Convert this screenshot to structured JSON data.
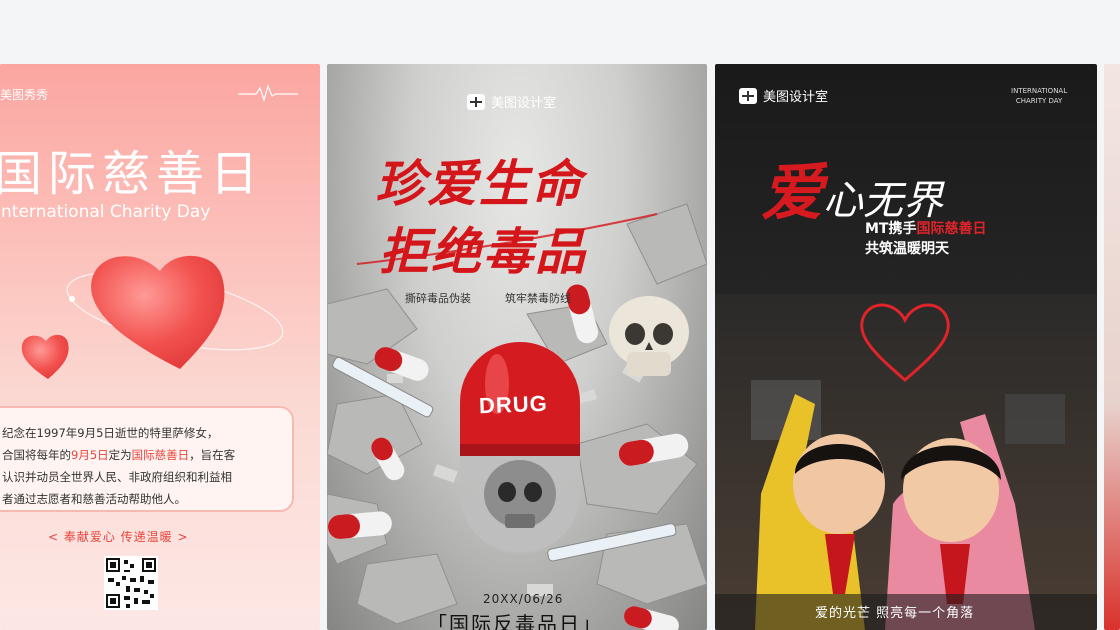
{
  "card1": {
    "brand": "美图秀秀",
    "title": "国际慈善日",
    "subtitle": "International Charity Day",
    "body_line1": "纪念在1997年9月5日逝世的特里萨修女，",
    "body_line2_pre": "合国将每年的",
    "body_line2_date": "9月5日",
    "body_line2_mid": "定为",
    "body_line2_name": "国际慈善日",
    "body_line2_post": "，旨在客",
    "body_line3": "认识并动员全世界人民、非政府组织和利益相",
    "body_line4": "者通过志愿者和慈善活动帮助他人。",
    "slogan": "<  奉献爱心   传递温暖  >",
    "accent_color": "#e8443b",
    "icons": [
      "heart-icon",
      "pulse-line-icon",
      "qr-code"
    ]
  },
  "card2": {
    "brand": "美图设计室",
    "title_line1": "珍爱生命",
    "title_line2": "拒绝毒品",
    "tag1": "撕碎毒品伪装",
    "tag2": "筑牢禁毒防线",
    "capsule_label": "DRUG",
    "date": "20XX/06/26",
    "bottom_title": "「国际反毒品日」",
    "accent_color": "#d4161b"
  },
  "card3": {
    "brand": "美图设计室",
    "intl_line1": "INTERNATIONAL",
    "intl_line2": "CHARITY DAY",
    "title_big": "爱",
    "title_rest": "心无界",
    "sub1_pre": "MT携手",
    "sub1_red": "国际慈善日",
    "sub2": "共筑温暖明天",
    "caption": "爱的光芒  照亮每一个角落",
    "accent_color": "#d61a1f"
  }
}
